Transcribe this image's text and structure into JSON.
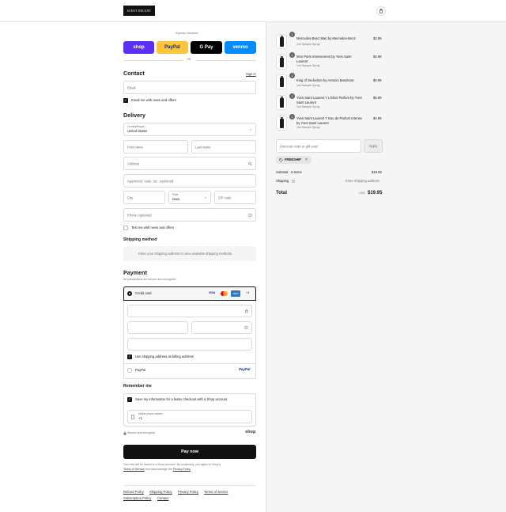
{
  "header": {
    "logo": "SCENT DECANT"
  },
  "express": {
    "title": "Express checkout",
    "or": "OR",
    "buttons": [
      {
        "label": "shop",
        "bg": "#5a31f4",
        "fg": "#ffffff"
      },
      {
        "label": "PayPal",
        "bg": "#ffc439",
        "fg": "#003087"
      },
      {
        "label": "G Pay",
        "bg": "#000000",
        "fg": "#ffffff"
      },
      {
        "label": "venmo",
        "bg": "#008cff",
        "fg": "#ffffff"
      }
    ]
  },
  "contact": {
    "heading": "Contact",
    "sign_in": "Sign in",
    "email_placeholder": "Email",
    "news_label": "Email me with news and offers"
  },
  "delivery": {
    "heading": "Delivery",
    "country_label": "Country/Region",
    "country_value": "United States",
    "first_name": "First name",
    "last_name": "Last name",
    "address": "Address",
    "apartment": "Apartment, suite, etc. (optional)",
    "city": "City",
    "state_label": "State",
    "state_value": "Iowa",
    "zip": "ZIP code",
    "phone": "Phone (optional)",
    "text_me": "Text me with news and offers"
  },
  "shipping": {
    "heading": "Shipping method",
    "placeholder": "Enter your shipping address to view available shipping methods."
  },
  "payment": {
    "heading": "Payment",
    "subtitle": "All transactions are secure and encrypted.",
    "credit_card": "Credit card",
    "card_brands": [
      "VISA",
      "MC",
      "AMEX"
    ],
    "more_cards": "+4",
    "billing_same": "Use shipping address as billing address",
    "paypal": "PayPal",
    "paypal_logo": "PayPal"
  },
  "remember": {
    "heading": "Remember me",
    "save_label": "Save my information for a faster checkout with a Shop account",
    "mobile_label": "Mobile phone number",
    "mobile_value": "+1",
    "secure": "Secure and encrypted",
    "shop_logo": "shop"
  },
  "pay_now": "Pay now",
  "disclaimer": {
    "line1": "Your info will be saved to a Shop account. By continuing, you agree to Shop’s",
    "terms": "Terms of Service",
    "and": "and acknowledge the",
    "privacy": "Privacy Policy",
    "end": "."
  },
  "footer_links": [
    "Refund Policy",
    "Shipping Policy",
    "Privacy Policy",
    "Terms of service",
    "Subscription Policy",
    "Contact"
  ],
  "order": {
    "items": [
      {
        "qty": "1",
        "name1": "Mercedes-Benz Man by Mercedes-Benz",
        "name2": "",
        "variant": "1ml Sample Spray",
        "price": "$2.99"
      },
      {
        "qty": "1",
        "name1": "Mon Paris Intensement by Yves Saint",
        "name2": "Laurent",
        "variant": "1ml Sample Spray",
        "price": "$4.99"
      },
      {
        "qty": "1",
        "name1": "King of Seduction by Antonio Banderas",
        "name2": "",
        "variant": "1ml Sample Spray",
        "price": "$0.99"
      },
      {
        "qty": "1",
        "name1": "Yves Saint Laurent Y L'Elixir Parfum by Yves",
        "name2": "Saint Laurent",
        "variant": "1ml Sample Spray",
        "price": "$5.99"
      },
      {
        "qty": "1",
        "name1": "Yves Saint Laurent Y Eau de Parfum Intense",
        "name2": "by Yves Saint Laurent",
        "variant": "1ml Sample Spray",
        "price": "$4.99"
      }
    ],
    "discount_placeholder": "Discount code or gift card",
    "apply": "Apply",
    "tag": "FREESHIP",
    "subtotal_label": "Subtotal · 5 items",
    "subtotal_value": "$19.95",
    "shipping_label": "Shipping",
    "shipping_value": "Enter shipping address",
    "total_label": "Total",
    "currency": "USD",
    "total_value": "$19.95"
  }
}
